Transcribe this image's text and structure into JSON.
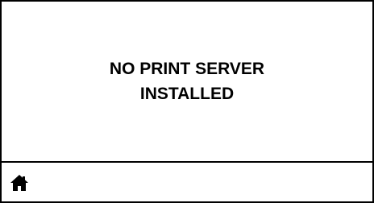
{
  "display": {
    "message_lines": [
      "NO PRINT SERVER",
      "INSTALLED"
    ]
  },
  "footer": {
    "home_icon": "home-icon"
  },
  "colors": {
    "foreground": "#000000",
    "background": "#ffffff"
  }
}
